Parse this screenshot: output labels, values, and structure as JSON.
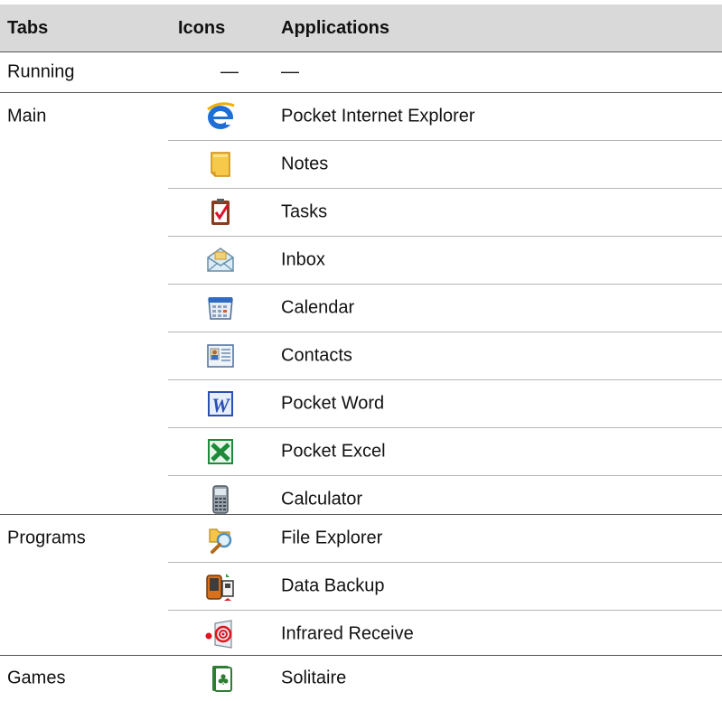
{
  "headers": {
    "tabs": "Tabs",
    "icons": "Icons",
    "applications": "Applications"
  },
  "running": {
    "tab": "Running",
    "icon": "—",
    "app": "—"
  },
  "groups": {
    "main": {
      "tab": "Main",
      "apps": [
        {
          "icon": "internet-explorer-icon",
          "label": "Pocket Internet Explorer"
        },
        {
          "icon": "notes-icon",
          "label": "Notes"
        },
        {
          "icon": "tasks-icon",
          "label": "Tasks"
        },
        {
          "icon": "inbox-icon",
          "label": "Inbox"
        },
        {
          "icon": "calendar-icon",
          "label": "Calendar"
        },
        {
          "icon": "contacts-icon",
          "label": "Contacts"
        },
        {
          "icon": "pocket-word-icon",
          "label": "Pocket Word"
        },
        {
          "icon": "pocket-excel-icon",
          "label": "Pocket Excel"
        },
        {
          "icon": "calculator-icon",
          "label": "Calculator"
        }
      ]
    },
    "programs": {
      "tab": "Programs",
      "apps": [
        {
          "icon": "file-explorer-icon",
          "label": "File Explorer"
        },
        {
          "icon": "data-backup-icon",
          "label": "Data Backup"
        },
        {
          "icon": "infrared-receive-icon",
          "label": "Infrared Receive"
        }
      ]
    },
    "games": {
      "tab": "Games",
      "apps": [
        {
          "icon": "solitaire-icon",
          "label": "Solitaire"
        }
      ]
    }
  }
}
